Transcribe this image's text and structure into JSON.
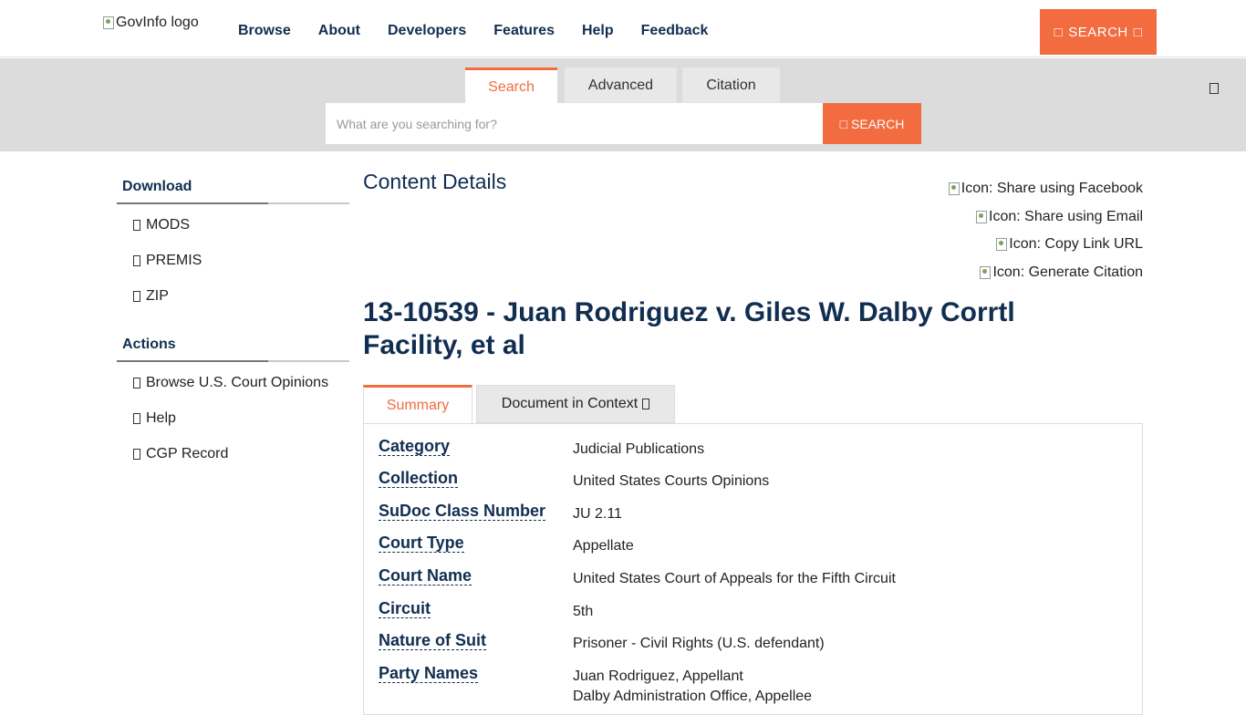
{
  "header": {
    "logo_alt": "GovInfo logo",
    "nav": [
      "Browse",
      "About",
      "Developers",
      "Features",
      "Help",
      "Feedback"
    ],
    "search_button": "SEARCH"
  },
  "search": {
    "tabs": [
      "Search",
      "Advanced",
      "Citation"
    ],
    "active_tab": "Search",
    "placeholder": "What are you searching for?",
    "button": "SEARCH"
  },
  "sidebar": {
    "download_heading": "Download",
    "download_items": [
      "MODS",
      "PREMIS",
      "ZIP"
    ],
    "actions_heading": "Actions",
    "action_items": [
      "Browse U.S. Court Opinions",
      "Help",
      "CGP Record"
    ]
  },
  "main": {
    "heading": "Content Details",
    "share": [
      "Icon: Share using Facebook",
      "Icon: Share using Email",
      "Icon: Copy Link URL",
      "Icon: Generate Citation"
    ],
    "title": "13-10539 - Juan Rodriguez v. Giles W. Dalby Corrtl Facility, et al",
    "tabs": [
      "Summary",
      "Document in Context"
    ],
    "details": [
      {
        "label": "Category",
        "value": "Judicial Publications"
      },
      {
        "label": "Collection",
        "value": "United States Courts Opinions"
      },
      {
        "label": "SuDoc Class Number",
        "value": "JU 2.11"
      },
      {
        "label": "Court Type",
        "value": "Appellate"
      },
      {
        "label": "Court Name",
        "value": "United States Court of Appeals for the Fifth Circuit"
      },
      {
        "label": "Circuit",
        "value": "5th"
      },
      {
        "label": "Nature of Suit",
        "value": "Prisoner - Civil Rights (U.S. defendant)"
      },
      {
        "label": "Party Names",
        "value": "Juan Rodriguez, Appellant",
        "value2": "Dalby Administration Office, Appellee"
      }
    ]
  },
  "colors": {
    "accent": "#f26c3f",
    "navy": "#112e51",
    "band": "#dcdcdc"
  }
}
